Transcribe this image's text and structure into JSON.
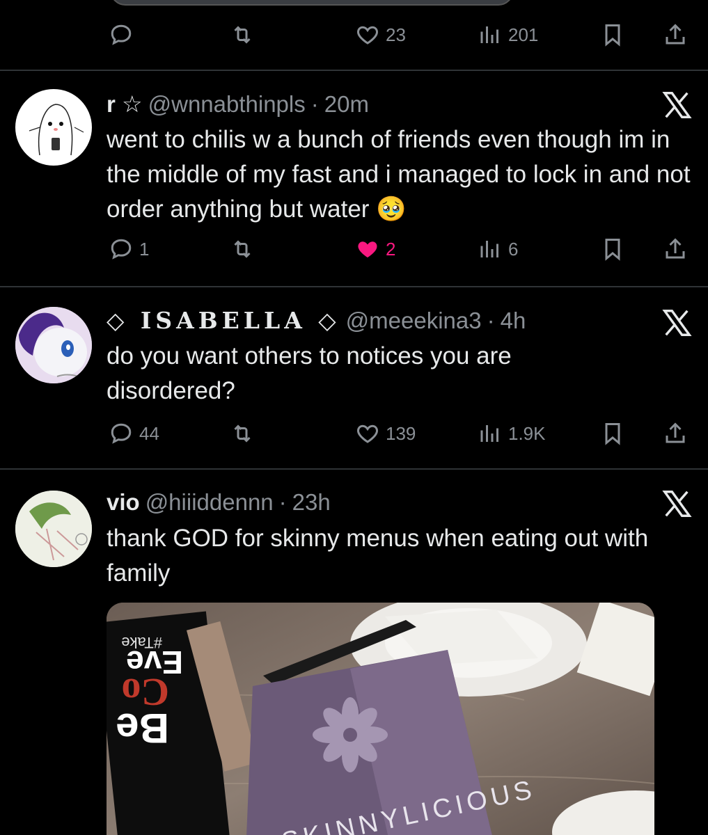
{
  "colors": {
    "background": "#000000",
    "text": "#e7e9ea",
    "muted": "#8b9096",
    "like": "#f91880",
    "divider": "#2f3336"
  },
  "top_tweet": {
    "actions": {
      "reply": "",
      "retweet": "",
      "likes": "23",
      "views": "201"
    }
  },
  "tweets": [
    {
      "name": "r ☆",
      "handle": "@wnnabthinpls",
      "sep": "·",
      "time": "20m",
      "text": "went to chilis w a bunch of friends even though im in the middle of my fast and i managed to lock in and not order anything but water 🥹",
      "replies": "1",
      "retweets": "",
      "likes": "2",
      "views": "6",
      "liked": true
    },
    {
      "name": "◇ ISABELLA ◇",
      "handle": "@meeekina3",
      "sep": "·",
      "time": "4h",
      "text": "do you want others to notices you are disordered?",
      "replies": "44",
      "retweets": "",
      "likes": "139",
      "views": "1.9K",
      "liked": false
    },
    {
      "name": "vio",
      "handle": "@hiiiddennn",
      "sep": "·",
      "time": "23h",
      "text": "thank GOD for skinny menus when eating out with family",
      "photo_text": {
        "book_title": "Be",
        "book_sub": "Co",
        "book_ev": "Eve",
        "book_tag": "#Take",
        "menu": "SKINNYLICIOUS"
      }
    }
  ],
  "icons": {
    "reply": "reply-icon",
    "retweet": "retweet-icon",
    "like": "heart-icon",
    "views": "views-icon",
    "bookmark": "bookmark-icon",
    "share": "share-icon",
    "x": "x-logo-icon"
  }
}
